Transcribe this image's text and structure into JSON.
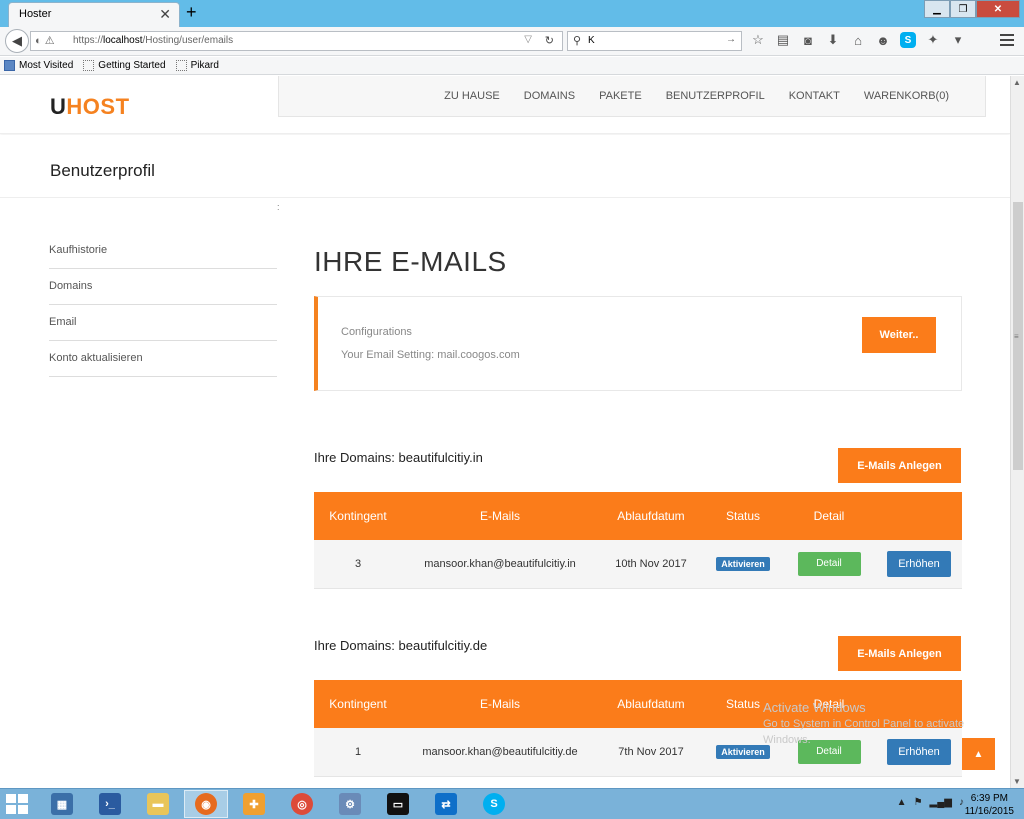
{
  "browser": {
    "tab_title": "Hoster",
    "tab_close": "✕",
    "new_tab": "+",
    "url_prefix": "https://",
    "url_host": "localhost",
    "url_path": "/Hosting/user/emails",
    "search_value": "K",
    "bookmarks": [
      "Most Visited",
      "Getting Started",
      "Pikard"
    ]
  },
  "site": {
    "logo_u": "U",
    "logo_rest": "HOST",
    "menu": [
      "ZU HAUSE",
      "DOMAINS",
      "PAKETE",
      "BENUTZERPROFIL",
      "KONTAKT",
      "WARENKORB(0)"
    ],
    "profile_title": "Benutzerprofil",
    "stray_char": ":"
  },
  "sidebar": {
    "items": [
      "Kaufhistorie",
      "Domains",
      "Email",
      "Konto aktualisieren"
    ]
  },
  "main": {
    "title": "IHRE E-MAILS",
    "config_label": "Configurations",
    "config_setting": "Your Email Setting: mail.coogos.com",
    "weiter_label": "Weiter.."
  },
  "domains": [
    {
      "title": "Ihre Domains: beautifulcitiy.in",
      "anlegen_label": "E-Mails Anlegen",
      "headers": [
        "Kontingent",
        "E-Mails",
        "Ablaufdatum",
        "Status",
        "Detail",
        ""
      ],
      "row": {
        "quota": "3",
        "email": "mansoor.khan@beautifulcitiy.in",
        "expiry": "10th Nov 2017",
        "status": "Aktivieren",
        "detail": "Detail",
        "action": "Erhöhen"
      }
    },
    {
      "title": "Ihre Domains: beautifulcitiy.de",
      "anlegen_label": "E-Mails Anlegen",
      "headers": [
        "Kontingent",
        "E-Mails",
        "Ablaufdatum",
        "Status",
        "Detail",
        ""
      ],
      "row": {
        "quota": "1",
        "email": "mansoor.khan@beautifulcitiy.de",
        "expiry": "7th Nov 2017",
        "status": "Aktivieren",
        "detail": "Detail",
        "action": "Erhöhen"
      }
    }
  ],
  "watermark": {
    "line1": "Activate Windows",
    "line2": "Go to System in Control Panel to activate",
    "line3": "Windows."
  },
  "taskbar": {
    "time": "6:39 PM",
    "date": "11/16/2015"
  },
  "colors": {
    "accent_orange": "#fb7c1a",
    "logo_orange": "#f58220",
    "status_blue": "#337ab7",
    "detail_green": "#5cb85c"
  }
}
